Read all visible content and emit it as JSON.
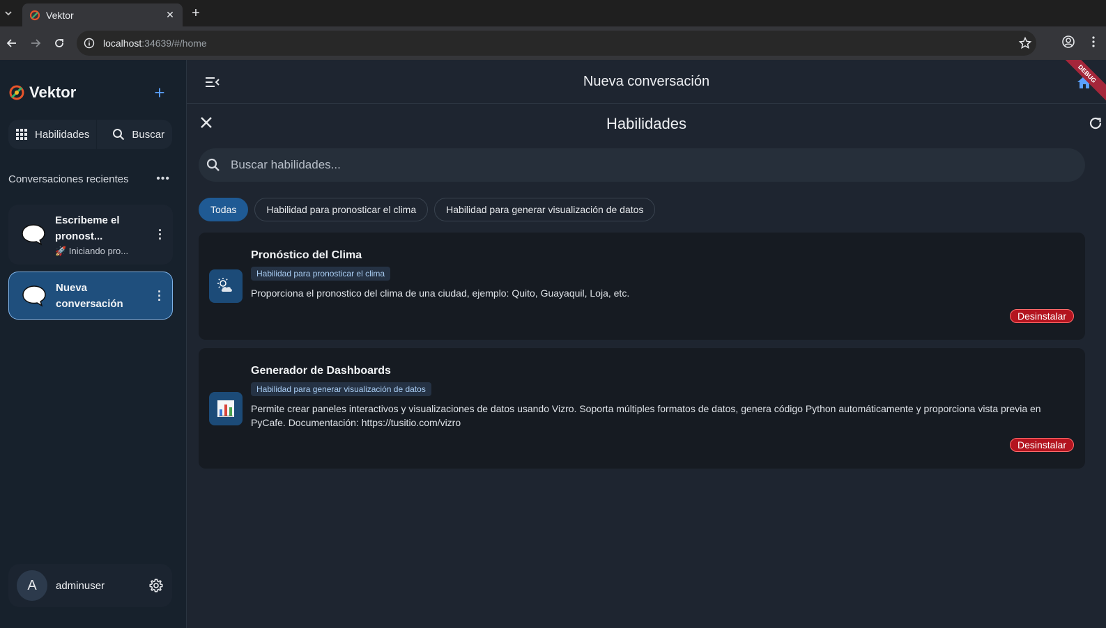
{
  "browser": {
    "tab_title": "Vektor",
    "url_host": "localhost",
    "url_rest": ":34639/#/home"
  },
  "sidebar": {
    "brand": "Vektor",
    "quick_actions": {
      "skills_label": "Habilidades",
      "search_label": "Buscar"
    },
    "recent_title": "Conversaciones recientes",
    "conversations": [
      {
        "title": "Escribeme el pronost...",
        "subtitle": "🚀 Iniciando pro..."
      },
      {
        "title": "Nueva conversación",
        "subtitle": ""
      }
    ],
    "user": {
      "initial": "A",
      "name": "adminuser"
    }
  },
  "main": {
    "title": "Nueva conversación",
    "debug_label": "DEBUG",
    "skills": {
      "title": "Habilidades",
      "search_placeholder": "Buscar habilidades...",
      "filters": [
        "Todas",
        "Habilidad para pronosticar el clima",
        "Habilidad para generar visualización de datos"
      ],
      "active_filter": "Todas",
      "items": [
        {
          "title": "Pronóstico del Clima",
          "tag": "Habilidad para pronosticar el clima",
          "description": "Proporciona el pronostico del clima de una ciudad, ejemplo: Quito, Guayaquil, Loja, etc.",
          "action": "Desinstalar",
          "icon": "weather-icon"
        },
        {
          "title": "Generador de Dashboards",
          "tag": "Habilidad para generar visualización de datos",
          "description": "Permite crear paneles interactivos y visualizaciones de datos usando Vizro. Soporta múltiples formatos de datos, genera código Python automáticamente y proporciona vista previa en PyCafe. Documentación: https://tusitio.com/vizro",
          "action": "Desinstalar",
          "icon": "bar-chart-icon"
        }
      ]
    }
  },
  "colors": {
    "accent": "#1f5a94",
    "danger": "#b3141f",
    "sidebar_bg": "#17212c",
    "main_bg": "#1e2530"
  }
}
